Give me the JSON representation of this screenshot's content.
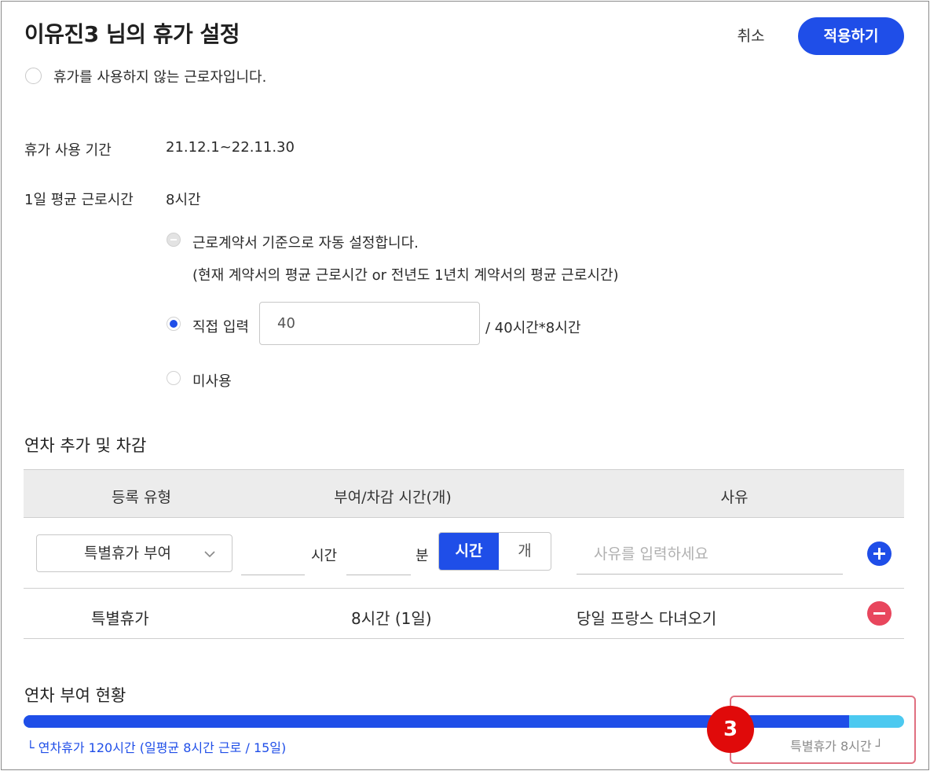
{
  "header": {
    "title": "이유진3 님의 휴가 설정",
    "cancel_label": "취소",
    "apply_label": "적용하기"
  },
  "no_leave_option": {
    "label": "휴가를 사용하지 않는 근로자입니다.",
    "checked": false
  },
  "leave_period": {
    "label": "휴가 사용 기간",
    "value": "21.12.1~22.11.30"
  },
  "avg_work_hours": {
    "label": "1일 평균 근로시간",
    "value": "8시간",
    "options": [
      {
        "label": "근로계약서 기준으로 자동 설정합니다.",
        "sub": "(현재 계약서의 평균 근로시간 or 전년도 1년치 계약서의 평균 근로시간)",
        "state": "disabled"
      },
      {
        "label": "직접 입력",
        "input_value": "40",
        "suffix": "/ 40시간*8시간",
        "state": "checked"
      },
      {
        "label": "미사용",
        "state": "unchecked"
      }
    ]
  },
  "adjust_section": {
    "title": "연차 추가 및 차감",
    "columns": [
      "등록 유형",
      "부여/차감 시간(개)",
      "사유"
    ],
    "form": {
      "type_select": "특별휴가 부여",
      "hour_unit": "시간",
      "minute_unit": "분",
      "toggle": [
        "시간",
        "개"
      ],
      "toggle_selected": "시간",
      "reason_placeholder": "사유를 입력하세요"
    },
    "rows": [
      {
        "type": "특별휴가",
        "amount": "8시간 (1일)",
        "reason": "당일 프랑스 다녀오기"
      }
    ]
  },
  "grant_status": {
    "title": "연차 부여 현황",
    "annual_fraction": 0.9375,
    "annual_label": "└ 연차휴가 120시간 (일평균 8시간 근로 / 15일)",
    "special_label": "특별휴가 8시간 ┘",
    "colors": {
      "annual": "#1f4ee8",
      "special": "#4cc9f0"
    }
  },
  "annotation": {
    "step": "3"
  }
}
